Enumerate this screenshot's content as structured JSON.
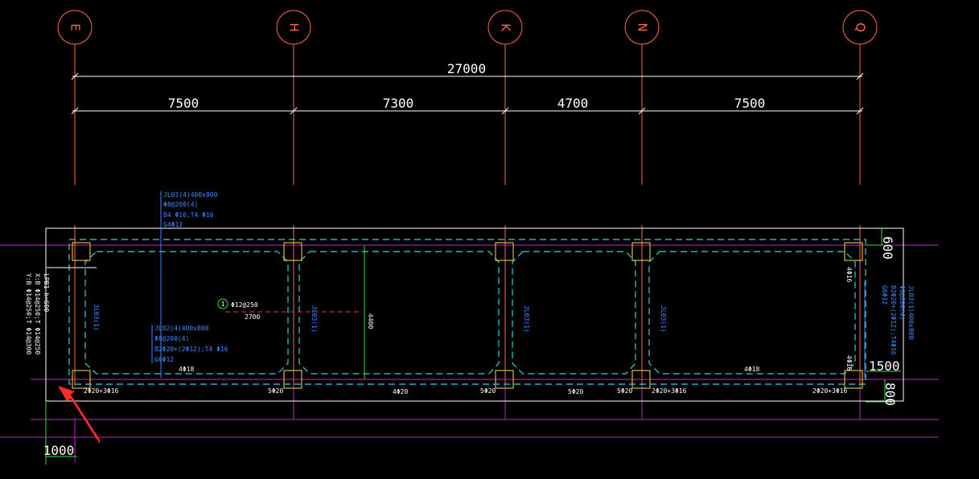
{
  "colors": {
    "background": "#000000",
    "axis_line": "#ff6a4d",
    "grid_magenta": "#c026c0",
    "dimension": "#ffffff",
    "beam_dashed": "#2fd6d6",
    "annotation_blue": "#3a8dff",
    "column": "#d9b84a",
    "section_green": "#33e633",
    "arrow_red": "#ff2a2a"
  },
  "axes": [
    {
      "label": "E"
    },
    {
      "label": "H"
    },
    {
      "label": "K"
    },
    {
      "label": "N"
    },
    {
      "label": "Q"
    }
  ],
  "dimensions": {
    "total": "27000",
    "spans": [
      "7500",
      "7300",
      "4700",
      "7500"
    ],
    "right_top": "600",
    "right_mid": "1500",
    "right_bottom": "800",
    "bottom_left": "1000",
    "slab_depth": "4400"
  },
  "annotations": {
    "beam_top": [
      "JL01(4)400x800",
      "Φ8@200(4)",
      "B4 Φ16;T4 Φ16",
      "G4Φ12"
    ],
    "beam_mid": [
      "JL02(4)400x800",
      "Φ8@200(4)",
      "B2Φ20+(2Φ12);T4 Φ16",
      "G6Φ12"
    ],
    "beam_right": [
      "JL03(1)400x800",
      "Φ8@200(4)",
      "B2Φ20+(2Φ12);T4Φ16",
      "G6Φ12"
    ],
    "left_vertical": [
      "LPB1 h=600",
      "X:B Φ14@250;T Φ14@250",
      "Y:B Φ14@250;T Φ14@300"
    ],
    "rebar_label": "Φ12@250",
    "rebar_length": "2700",
    "section_marker": "1",
    "inner_labels": [
      "JL03(1)",
      "JL03(1)",
      "JL03(1)",
      "JL03(1)"
    ],
    "side_labels": [
      "4Φ18",
      "4Φ18"
    ],
    "corner_labels": [
      "4Φ16",
      "4Φ16"
    ],
    "bottom_labels": [
      "2Φ20+3Φ16",
      "5Φ20",
      "4Φ20",
      "5Φ20",
      "5Φ20",
      "5Φ20",
      "2Φ20+3Φ16",
      "2Φ20+3Φ16"
    ]
  }
}
